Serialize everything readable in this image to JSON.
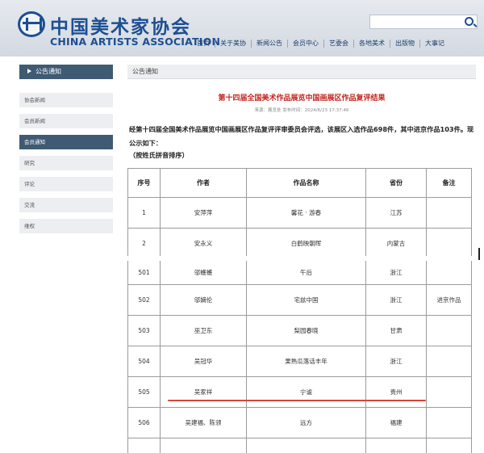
{
  "header": {
    "logo_cn": "中国美术家协会",
    "logo_en": "CHINA ARTISTS ASSOCIATION",
    "nav": [
      "首页",
      "关于美协",
      "新闻公告",
      "会员中心",
      "艺委会",
      "各地美术",
      "出版物",
      "大事记"
    ]
  },
  "sidebar": {
    "heading": "公告通知",
    "items": [
      "协会新闻",
      "会员新闻",
      "会员通知",
      "研究",
      "评论",
      "交流",
      "维权"
    ],
    "active_index": 2
  },
  "content": {
    "section_title": "公告通知",
    "article_title": "第十四届全国美术作品展览中国画展区作品复评结果",
    "meta": "来源：展览处   发布时间：2024/6/23 17:37:46",
    "intro": "经第十四届全国美术作品展览中国画展区作品复评评审委员会评选，该展区入选作品698件，其中进京作品103件。现公示如下：",
    "order_note": "（按姓氏拼音排序）"
  },
  "table": {
    "headers": [
      "序号",
      "作者",
      "作品名称",
      "省份",
      "备注"
    ],
    "rows_top": [
      [
        "1",
        "安萍萍",
        "馨花 · 游春",
        "江苏",
        ""
      ],
      [
        "2",
        "安永义",
        "白鹤映朝晖",
        "内蒙古",
        ""
      ]
    ],
    "rows_bottom": [
      [
        "501",
        "邬蠖蠖",
        "午后",
        "浙江",
        ""
      ],
      [
        "502",
        "邬嫡伦",
        "宅兹中国",
        "浙江",
        "进京作品"
      ],
      [
        "503",
        "巫卫东",
        "梨园春晓",
        "甘肃",
        ""
      ],
      [
        "504",
        "吴冠华",
        "果熟瓜落话丰年",
        "浙江",
        ""
      ],
      [
        "505",
        "吴家祥",
        "宁谧",
        "贵州",
        ""
      ],
      [
        "506",
        "吴建福、陈领",
        "远方",
        "福建",
        ""
      ]
    ]
  },
  "colors": {
    "brand_blue": "#1d4f91",
    "sidebar_active": "#3f5a73",
    "title_red": "#c1241e",
    "highlight_red": "#d8463a"
  }
}
